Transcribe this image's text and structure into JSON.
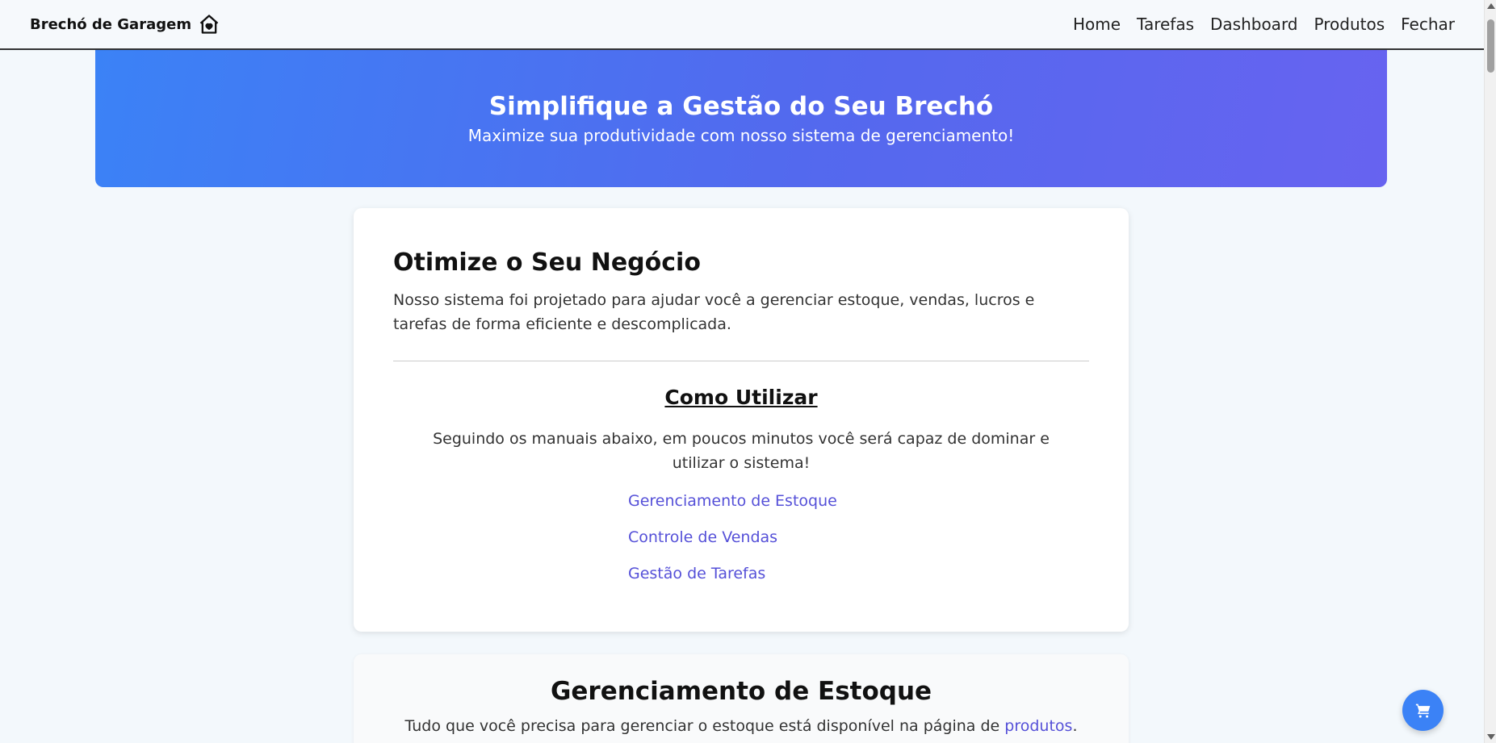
{
  "nav": {
    "brand": "Brechó de Garagem",
    "brand_icon": "home-heart-icon",
    "links": [
      "Home",
      "Tarefas",
      "Dashboard",
      "Produtos",
      "Fechar"
    ]
  },
  "hero": {
    "title": "Simplifique a Gestão do Seu Brechó",
    "subtitle": "Maximize sua produtividade com nosso sistema de gerenciamento!",
    "gradient_start": "#3b82f6",
    "gradient_end": "#6763f0"
  },
  "intro": {
    "title": "Otimize o Seu Negócio",
    "description": "Nosso sistema foi projetado para ajudar você a gerenciar estoque, vendas, lucros e tarefas de forma eficiente e descomplicada.",
    "how_title": "Como Utilizar",
    "how_text": "Seguindo os manuais abaixo, em poucos minutos você será capaz de dominar e utilizar o sistema!",
    "links": [
      "Gerenciamento de Estoque",
      "Controle de Vendas",
      "Gestão de Tarefas"
    ],
    "link_color": "#5550d8"
  },
  "estoque": {
    "title": "Gerenciamento de Estoque",
    "text_before": "Tudo que você precisa para gerenciar o estoque está disponível na página de ",
    "link": "produtos",
    "text_after": "."
  },
  "fab": {
    "icon": "shopping-cart-icon",
    "color": "#3b82f6"
  }
}
